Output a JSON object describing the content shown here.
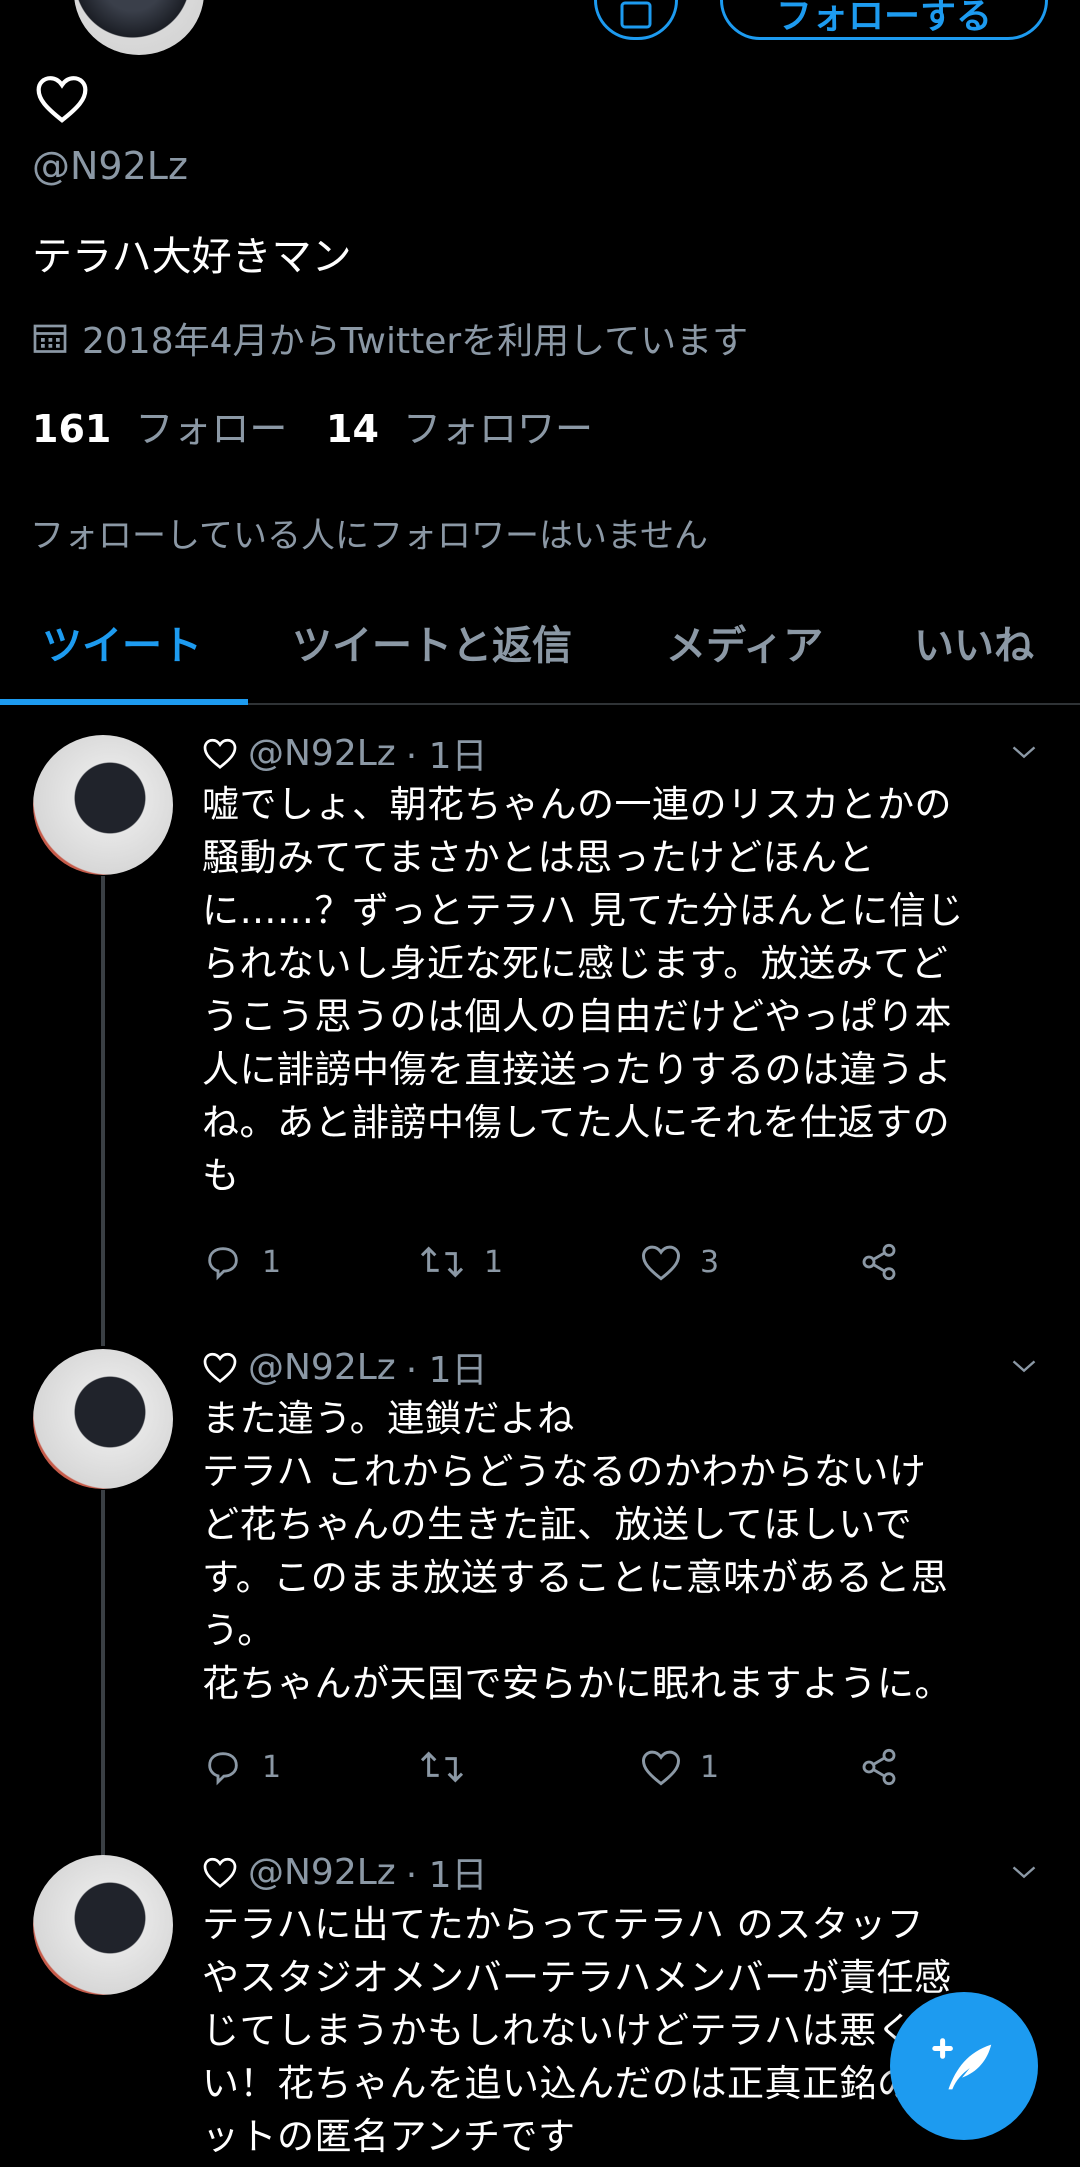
{
  "profile": {
    "follow_button_label": "フォローする",
    "handle": "@N92Lz",
    "bio": "テラハ大好きマン",
    "joined": "2018年4月からTwitterを利用しています",
    "following_count": "161",
    "following_label": "フォロー",
    "followers_count": "14",
    "followers_label": "フォロワー",
    "followed_by_note": "フォローしている人にフォロワーはいません"
  },
  "tabs": [
    {
      "label": "ツイート",
      "active": true
    },
    {
      "label": "ツイートと返信",
      "active": false
    },
    {
      "label": "メディア",
      "active": false
    },
    {
      "label": "いいね",
      "active": false
    }
  ],
  "tweets": [
    {
      "handle": "@N92Lz",
      "time": "· 1日",
      "text": "嘘でしょ、朝花ちゃんの一連のリスカとかの\n騒動みててまさかとは思ったけどほんと\nに……？ずっとテラハ 見てた分ほんとに信じ\nられないし身近な死に感じます。放送みてど\nうこう思うのは個人の自由だけどやっぱり本\n人に誹謗中傷を直接送ったりするのは違うよ\nね。あと誹謗中傷してた人にそれを仕返すの\nも",
      "replies": "1",
      "retweets": "1",
      "likes": "3"
    },
    {
      "handle": "@N92Lz",
      "time": "· 1日",
      "text": "また違う。連鎖だよね\nテラハ これからどうなるのかわからないけ\nど花ちゃんの生きた証、放送してほしいで\nす。このまま放送することに意味があると思\nう。\n花ちゃんが天国で安らかに眠れますように。",
      "replies": "1",
      "retweets": "",
      "likes": "1"
    },
    {
      "handle": "@N92Lz",
      "time": "· 1日",
      "text": "テラハに出てたからってテラハ のスタッフ\nやスタジオメンバーテラハメンバーが責任感\nじてしまうかもしれないけどテラハは悪くな\nい！花ちゃんを追い込んだのは正真正銘のネ\nットの匿名アンチです",
      "replies": "",
      "retweets": "",
      "likes": ""
    }
  ],
  "colors": {
    "accent": "#1d9bf0",
    "muted": "#8b98a5",
    "background": "#000000"
  }
}
